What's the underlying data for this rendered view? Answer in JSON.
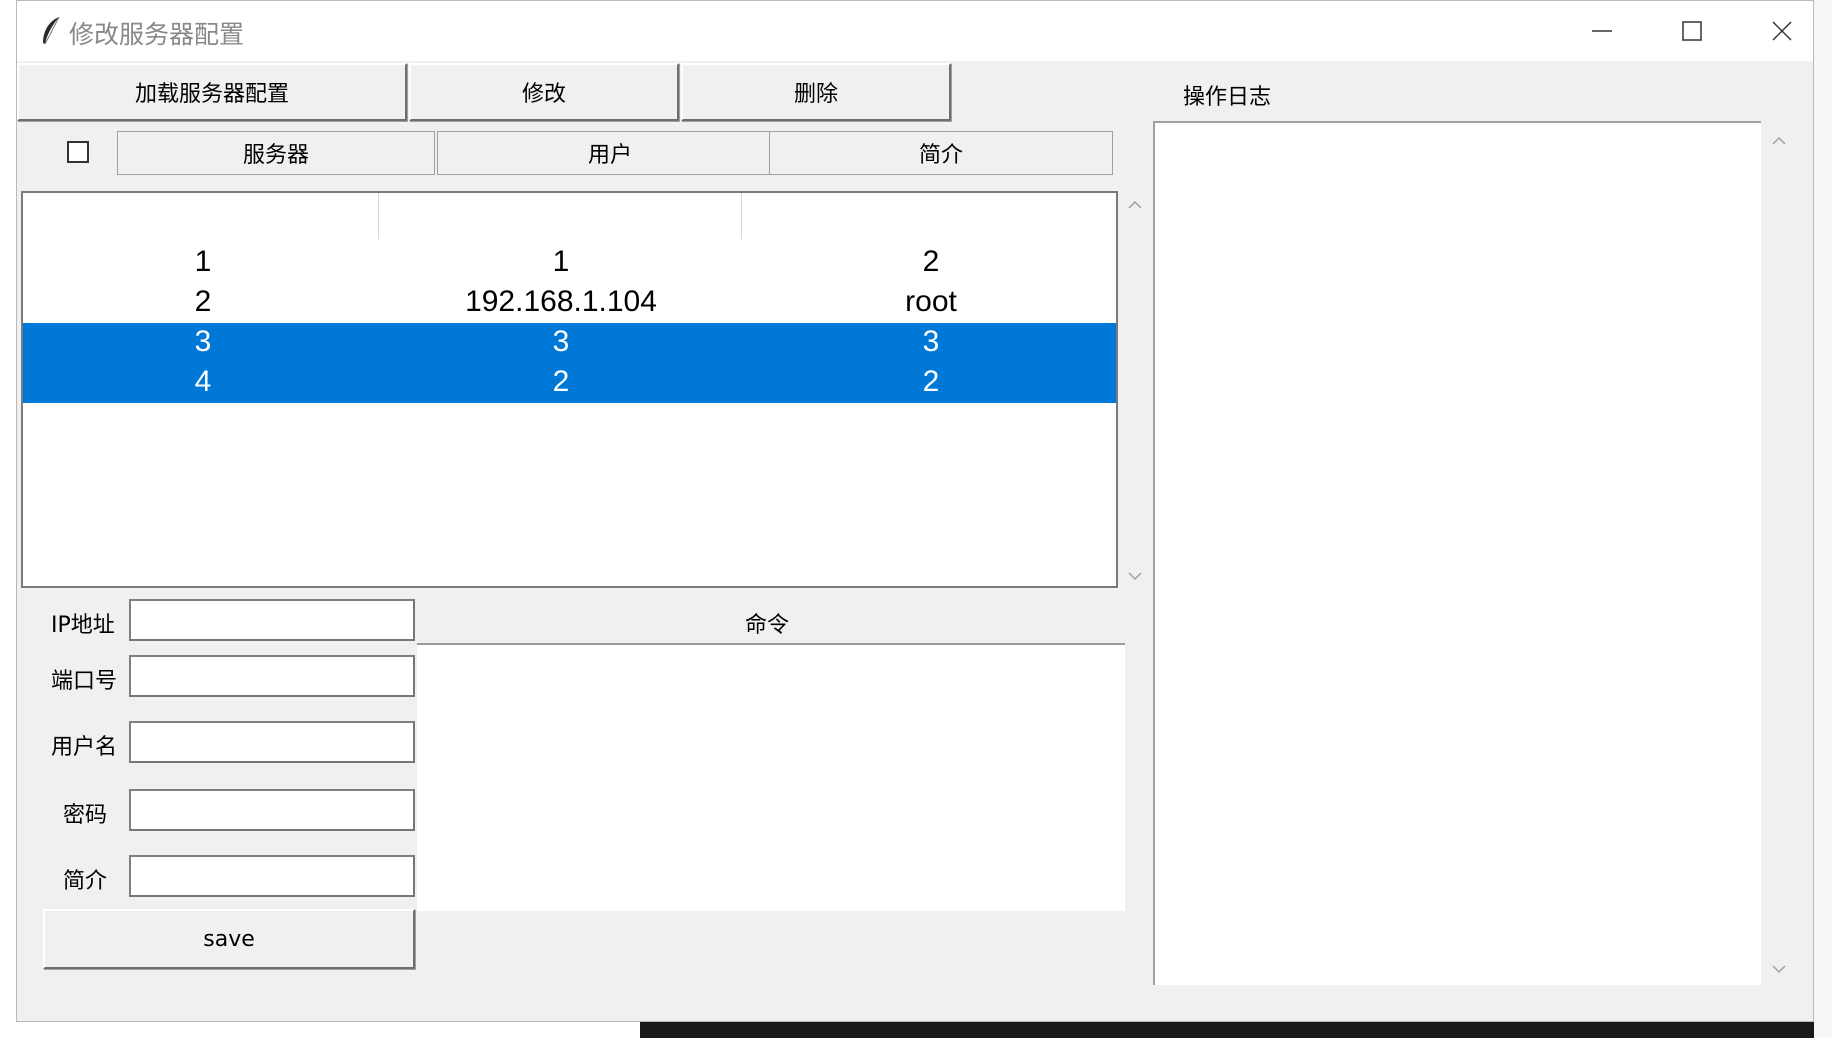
{
  "window": {
    "title": "修改服务器配置",
    "icon": "feather-icon",
    "controls": [
      "minimize-icon",
      "maximize-icon",
      "close-icon"
    ]
  },
  "toolbar": {
    "load_label": "加载服务器配置",
    "modify_label": "修改",
    "delete_label": "删除",
    "log_title": "操作日志"
  },
  "table": {
    "select_all_checked": false,
    "headers": [
      "服务器",
      "用户",
      "简介"
    ],
    "rows": [
      {
        "c1": "1",
        "c2": "1",
        "c3": "2",
        "selected": false
      },
      {
        "c1": "2",
        "c2": "192.168.1.104",
        "c3": "root",
        "selected": false
      },
      {
        "c1": "3",
        "c2": "3",
        "c3": "3",
        "selected": true
      },
      {
        "c1": "4",
        "c2": "2",
        "c3": "2",
        "selected": true
      }
    ],
    "selection_color": "#0078d7"
  },
  "form": {
    "ip_label": "IP地址",
    "port_label": "端口号",
    "user_label": "用户名",
    "password_label": "密码",
    "desc_label": "简介",
    "ip_value": "",
    "port_value": "",
    "user_value": "",
    "password_value": "",
    "desc_value": "",
    "save_label": "save"
  },
  "command": {
    "label": "命令",
    "value": ""
  },
  "log": {
    "value": ""
  }
}
